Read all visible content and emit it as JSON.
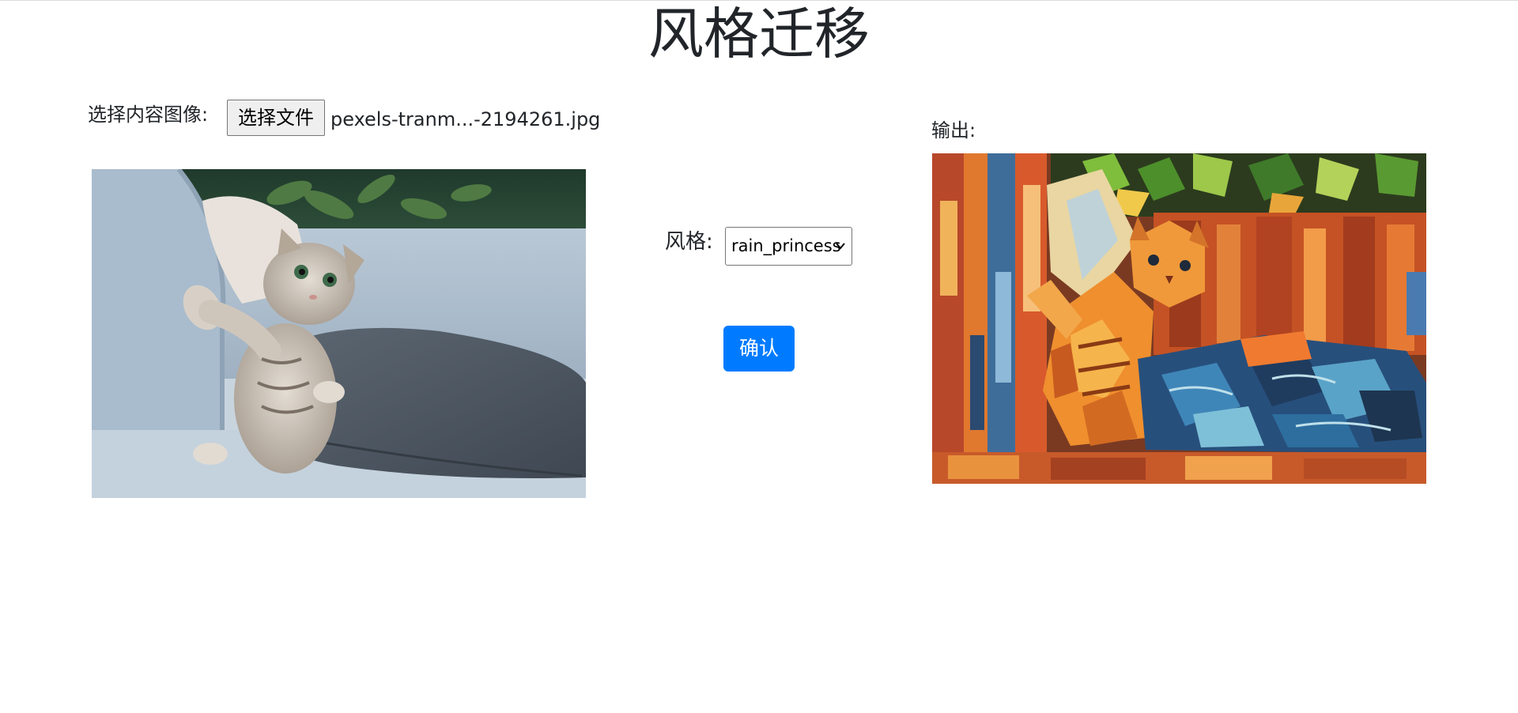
{
  "page": {
    "title": "风格迁移"
  },
  "content": {
    "label": "选择内容图像:",
    "file_button": "选择文件",
    "file_name": "pexels-tranm...-2194261.jpg"
  },
  "style": {
    "label": "风格:",
    "selected": "rain_princess"
  },
  "confirm": {
    "label": "确认"
  },
  "output": {
    "label": "输出:"
  },
  "colors": {
    "accent": "#007bff",
    "text": "#212529"
  },
  "icons": {
    "select_arrow": "chevron-down-icon"
  }
}
